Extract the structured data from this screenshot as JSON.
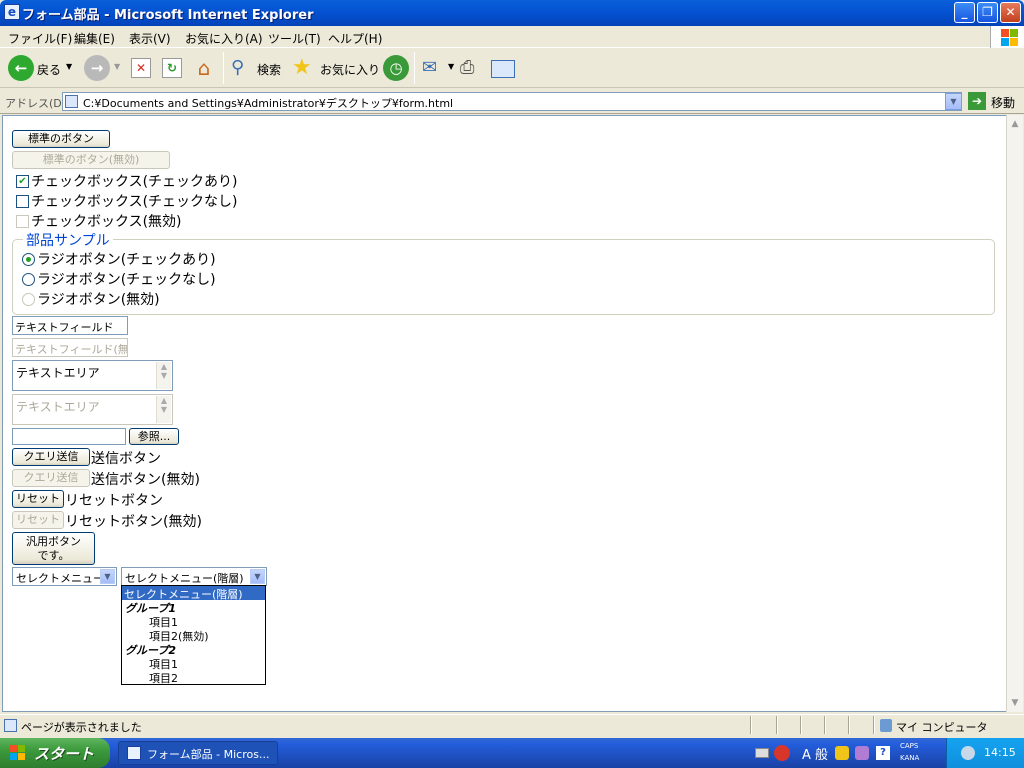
{
  "window": {
    "title": "フォーム部品 - Microsoft Internet Explorer"
  },
  "menu": [
    "ファイル(F)",
    "編集(E)",
    "表示(V)",
    "お気に入り(A)",
    "ツール(T)",
    "ヘルプ(H)"
  ],
  "toolbar": {
    "back": "戻る",
    "search": "検索",
    "favorites": "お気に入り"
  },
  "address": {
    "label": "アドレス(D)",
    "url": "C:¥Documents and Settings¥Administrator¥デスクトップ¥form.html",
    "go": "移動"
  },
  "form": {
    "btn_standard": "標準のボタン",
    "btn_standard_disabled": "標準のボタン(無効)",
    "cb_checked": "チェックボックス(チェックあり)",
    "cb_unchecked": "チェックボックス(チェックなし)",
    "cb_disabled": "チェックボックス(無効)",
    "fieldset_legend": "部品サンプル",
    "rb_checked": "ラジオボタン(チェックあり)",
    "rb_unchecked": "ラジオボタン(チェックなし)",
    "rb_disabled": "ラジオボタン(無効)",
    "text_field": "テキストフィールド",
    "text_field_disabled": "テキストフィールド(無効)",
    "textarea": "テキストエリア",
    "textarea_disabled": "テキストエリア",
    "browse": "参照...",
    "submit": "クエリ送信",
    "submit_label": "送信ボタン",
    "submit_disabled": "クエリ送信",
    "submit_disabled_label": "送信ボタン(無効)",
    "reset": "リセット",
    "reset_label": "リセットボタン",
    "reset_disabled": "リセット",
    "reset_disabled_label": "リセットボタン(無効)",
    "generic_button": "汎用ボタン\nです。",
    "select1": "セレクトメニュー",
    "select2": "セレクトメニュー(階層)",
    "dropdown": [
      "セレクトメニュー(階層)",
      "グループ1",
      "項目1",
      "項目2(無効)",
      "グループ2",
      "項目1",
      "項目2"
    ]
  },
  "status": {
    "text": "ページが表示されました",
    "zone": "マイ コンピュータ"
  },
  "taskbar": {
    "start": "スタート",
    "item": "フォーム部品 - Micros...",
    "clock": "14:15",
    "ime": "A 般",
    "caps": "CAPS",
    "kana": "KANA"
  }
}
